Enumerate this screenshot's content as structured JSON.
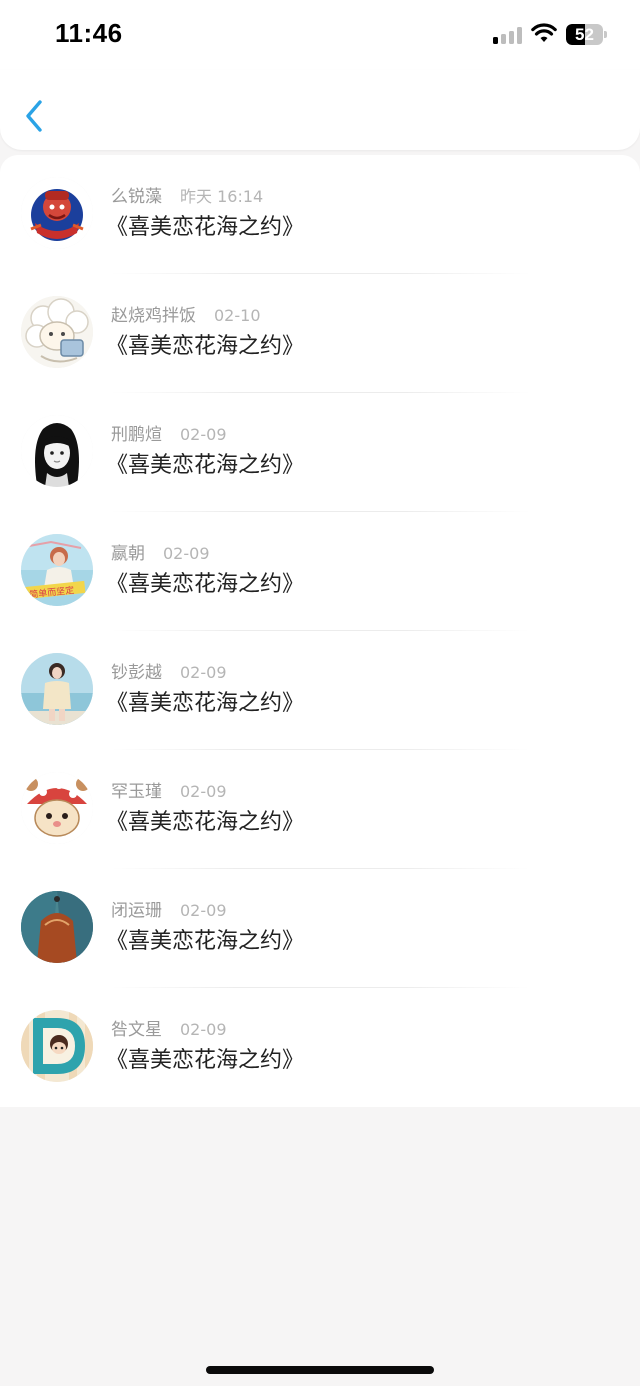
{
  "status_bar": {
    "time": "11:46",
    "battery_level": "52",
    "battery_fraction": 0.52,
    "signal_bars_active": 1,
    "signal_bars_total": 4
  },
  "nav": {
    "back_icon": "chevron-left-icon",
    "accent_color": "#2aa3e6"
  },
  "list": {
    "items": [
      {
        "name": "么锐藻",
        "date": "昨天 16:14",
        "title": "《喜美恋花海之约》",
        "avatar": "red-warrior-avatar"
      },
      {
        "name": "赵烧鸡拌饭",
        "date": "02-10",
        "title": "《喜美恋花海之约》",
        "avatar": "sheep-cartoon-avatar"
      },
      {
        "name": "刑鹏煊",
        "date": "02-09",
        "title": "《喜美恋花海之约》",
        "avatar": "sketch-girl-avatar"
      },
      {
        "name": "嬴朝",
        "date": "02-09",
        "title": "《喜美恋花海之约》",
        "avatar": "beach-girl-avatar"
      },
      {
        "name": "钞彭越",
        "date": "02-09",
        "title": "《喜美恋花海之约》",
        "avatar": "seaside-woman-avatar"
      },
      {
        "name": "罕玉瑾",
        "date": "02-09",
        "title": "《喜美恋花海之约》",
        "avatar": "mushroom-hamster-avatar"
      },
      {
        "name": "闭运珊",
        "date": "02-09",
        "title": "《喜美恋花海之约》",
        "avatar": "denim-photo-avatar"
      },
      {
        "name": "咎文星",
        "date": "02-09",
        "title": "《喜美恋花海之约》",
        "avatar": "letter-d-avatar"
      }
    ]
  }
}
